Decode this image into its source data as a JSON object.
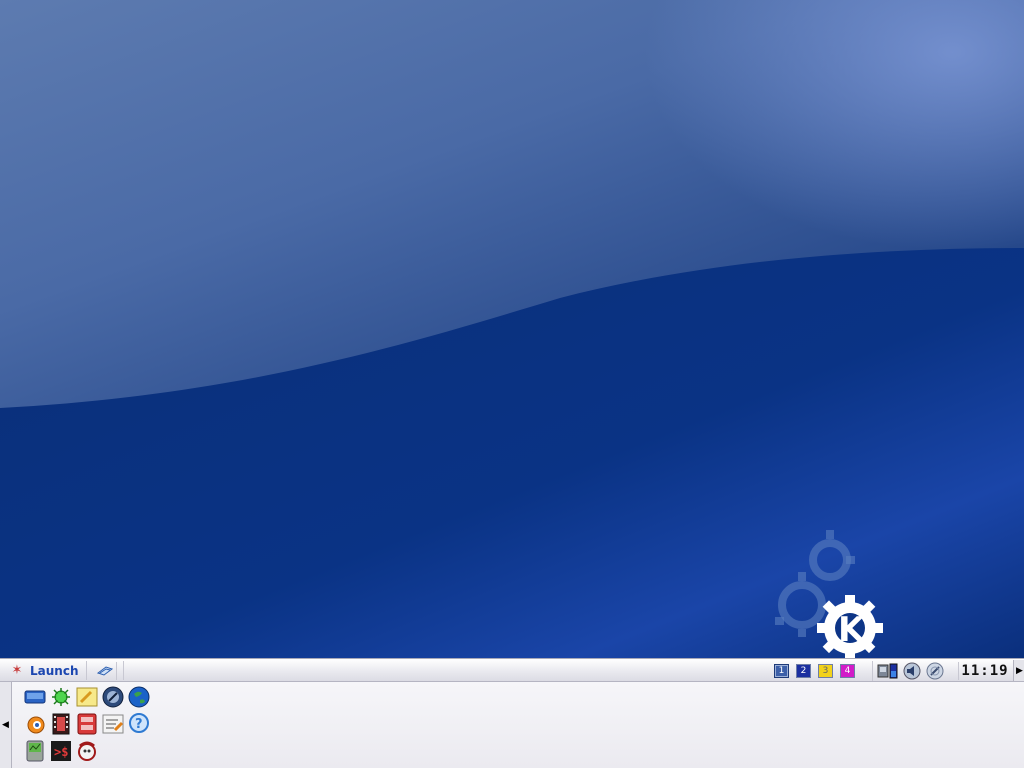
{
  "desktop": {
    "logo": "kde-gear-logo"
  },
  "taskbar": {
    "launch_label": "Launch",
    "launch_icon": "kde-menu-icon",
    "show_desktop_icon": "show-desktop-icon",
    "pager": {
      "desktops": [
        {
          "label": "1",
          "active": true,
          "color": "#3c5fa8"
        },
        {
          "label": "2",
          "active": false,
          "color": "#1b2fa0"
        },
        {
          "label": "3",
          "active": false,
          "color": "#f2d21b"
        },
        {
          "label": "4",
          "active": false,
          "color": "#d21bc8"
        }
      ]
    },
    "tray_icons": [
      "monitor-icon",
      "volume-icon",
      "network-icon"
    ],
    "clock": "11:19"
  },
  "quick_launcher": {
    "icons": [
      "display-icon",
      "bug-icon",
      "notes-icon",
      "terminal-icon",
      "globe-icon",
      "blender-icon",
      "film-icon",
      "media-player-icon",
      "document-edit-icon",
      "help-icon",
      "system-monitor-icon",
      "console-icon",
      "konqueror-icon"
    ]
  }
}
